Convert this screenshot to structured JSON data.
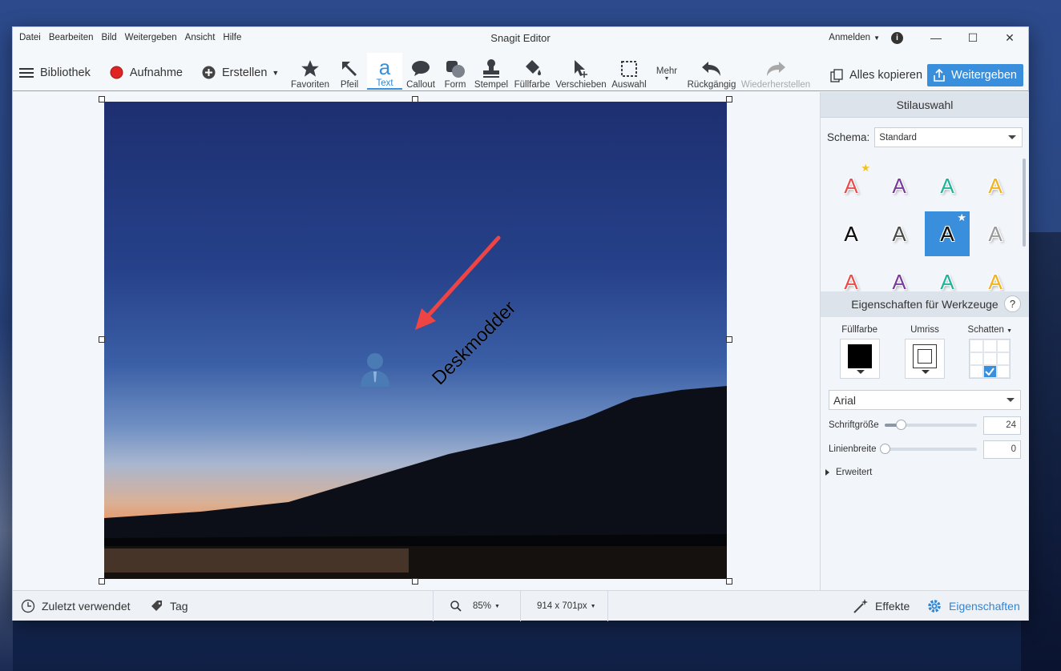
{
  "menu": [
    "Datei",
    "Bearbeiten",
    "Bild",
    "Weitergeben",
    "Ansicht",
    "Hilfe"
  ],
  "app_title": "Snagit Editor",
  "signin_label": "Anmelden",
  "nav": {
    "library": "Bibliothek",
    "capture": "Aufnahme",
    "create": "Erstellen"
  },
  "tools": [
    {
      "label": "Favoriten",
      "icon": "star-icon"
    },
    {
      "label": "Pfeil",
      "icon": "arrow-icon"
    },
    {
      "label": "Text",
      "icon": "text-icon",
      "active": true
    },
    {
      "label": "Callout",
      "icon": "callout-icon"
    },
    {
      "label": "Form",
      "icon": "shape-icon"
    },
    {
      "label": "Stempel",
      "icon": "stamp-icon"
    },
    {
      "label": "Füllfarbe",
      "icon": "fill-icon"
    },
    {
      "label": "Verschieben",
      "icon": "move-icon"
    },
    {
      "label": "Auswahl",
      "icon": "selection-icon"
    },
    {
      "label": "Mehr",
      "icon": "more-icon"
    },
    {
      "label": "Rückgängig",
      "icon": "undo-icon"
    },
    {
      "label": "Wiederherstellen",
      "icon": "redo-icon",
      "disabled": true
    }
  ],
  "copy_all_label": "Alles kopieren",
  "share_label": "Weitergeben",
  "canvas": {
    "annotation_text": "Deskmodder"
  },
  "panel": {
    "style_title": "Stilauswahl",
    "schema_label": "Schema:",
    "schema_value": "Standard",
    "styles_letter": "A",
    "style_colors": [
      "#e84c4c",
      "#7a3c9c",
      "#1fb39a",
      "#f2b21f",
      "#111111",
      "#4a4a4a",
      "#111111",
      "#9a9a9a",
      "#e84c4c",
      "#7a3c9c",
      "#1fb39a",
      "#f2b21f"
    ],
    "props_title": "Eigenschaften für Werkzeuge",
    "help": "?",
    "fill_label": "Füllfarbe",
    "outline_label": "Umriss",
    "shadow_label": "Schatten",
    "font_value": "Arial",
    "font_size_label": "Schriftgröße",
    "font_size_value": "24",
    "font_size_level": 0.17,
    "line_width_label": "Linienbreite",
    "line_width_value": "0",
    "line_width_level": 0,
    "advanced_label": "Erweitert"
  },
  "status": {
    "recent": "Zuletzt verwendet",
    "tag": "Tag",
    "zoom": "85%",
    "dimensions": "914 x 701px",
    "effects": "Effekte",
    "properties": "Eigenschaften"
  },
  "colors": {
    "accent": "#3a8fdc",
    "arrow_red": "#ef4444"
  }
}
